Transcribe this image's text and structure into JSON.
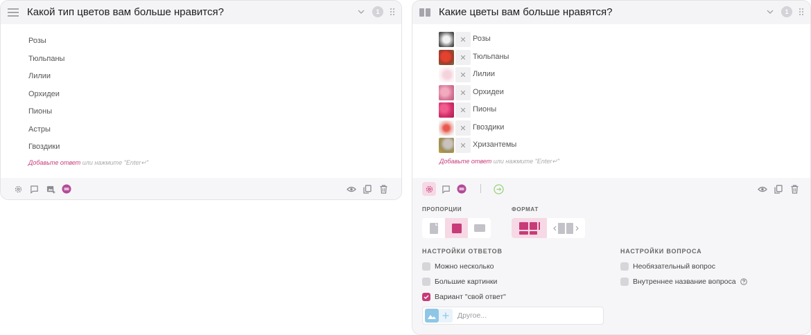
{
  "left_card": {
    "title": "Какой тип цветов вам больше нравится?",
    "badge": "1",
    "answers": [
      "Розы",
      "Тюльпаны",
      "Лилии",
      "Орхидеи",
      "Пионы",
      "Астры",
      "Гвоздики"
    ],
    "add_link": "Добавьте ответ",
    "add_hint": " или нажмите \"Enter↵\""
  },
  "right_card": {
    "title": "Какие цветы вам больше нравятся?",
    "badge": "1",
    "answers": [
      "Розы",
      "Тюльпаны",
      "Лилии",
      "Орхидеи",
      "Пионы",
      "Гвоздики",
      "Хризантемы"
    ],
    "add_link": "Добавьте ответ",
    "add_hint": " или нажмите \"Enter↵\"",
    "proportions_label": "ПРОПОРЦИИ",
    "format_label": "ФОРМАТ",
    "answer_settings_label": "НАСТРОЙКИ ОТВЕТОВ",
    "question_settings_label": "НАСТРОЙКИ ВОПРОСА",
    "answer_settings": [
      {
        "label": "Можно несколько",
        "checked": false
      },
      {
        "label": "Большие картинки",
        "checked": false
      },
      {
        "label": "Вариант \"свой ответ\"",
        "checked": true
      }
    ],
    "question_settings": [
      {
        "label": "Необязательный вопрос",
        "checked": false
      },
      {
        "label": "Внутреннее название вопроса",
        "checked": false
      }
    ],
    "other_placeholder": "Другое..."
  },
  "colors": {
    "accent": "#c73b78",
    "accent_light": "#f6d9e5",
    "header_bg": "#f4f4f6",
    "icon_gray": "#8a8a90"
  },
  "icons": {
    "list": "list-icon",
    "image_card": "image-card-icon",
    "chevron": "chevron-down-icon",
    "drag": "drag-handle-icon",
    "settings": "gear-icon",
    "comment": "comment-icon",
    "add_image": "add-image-icon",
    "logic": "logic-icon",
    "link": "link-icon",
    "preview": "eye-refresh-icon",
    "copy": "copy-icon",
    "delete": "trash-icon",
    "help": "help-icon"
  }
}
